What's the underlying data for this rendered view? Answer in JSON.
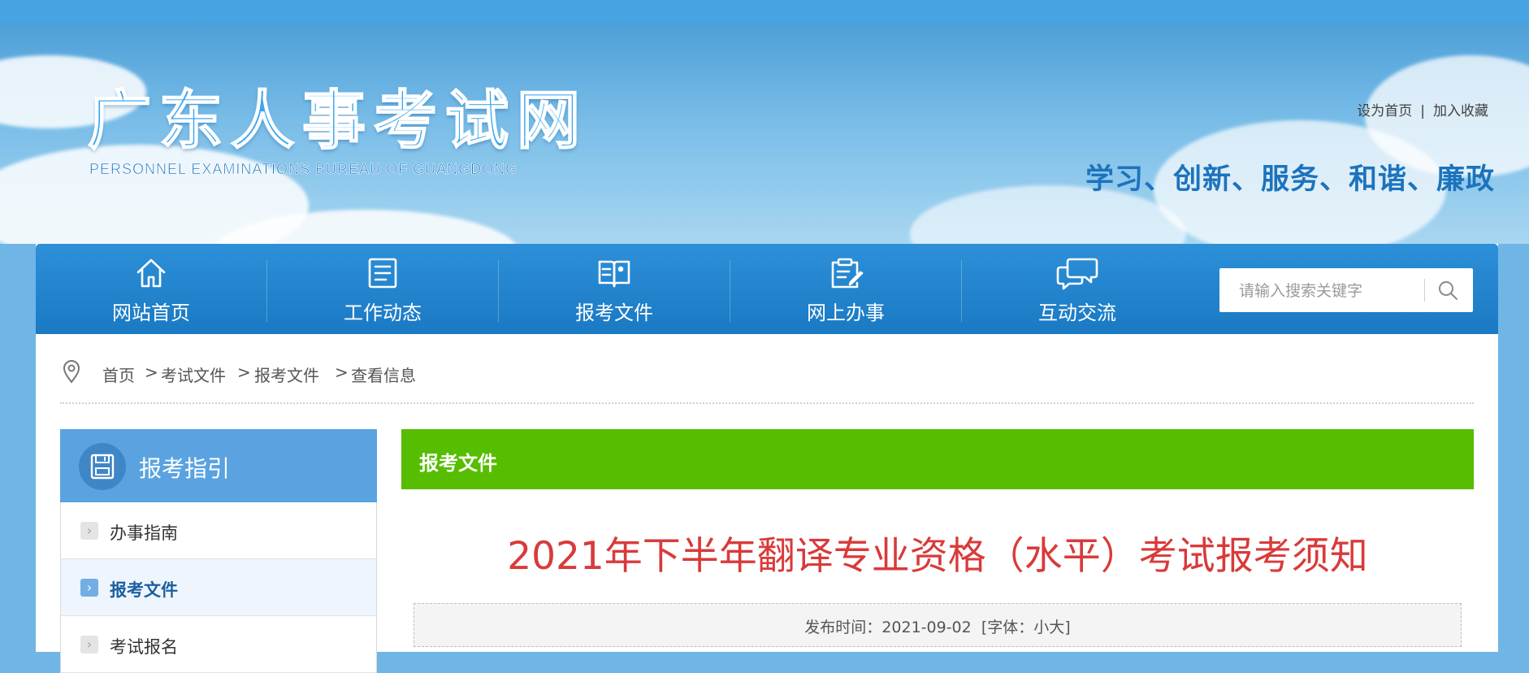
{
  "header": {
    "logo_cn": "广东人事考试网",
    "logo_en": "PERSONNEL EXAMINATIONS BUREAU OF GUANGDONG",
    "set_homepage": "设为首页",
    "separator": "|",
    "add_favorite": "加入收藏",
    "slogan": "学习、创新、服务、和谐、廉政"
  },
  "nav": {
    "items": [
      {
        "label": "网站首页",
        "icon": "home-icon"
      },
      {
        "label": "工作动态",
        "icon": "document-list-icon"
      },
      {
        "label": "报考文件",
        "icon": "open-book-icon"
      },
      {
        "label": "网上办事",
        "icon": "clipboard-pen-icon"
      },
      {
        "label": "互动交流",
        "icon": "chat-bubbles-icon"
      }
    ],
    "search_placeholder": "请输入搜索关键字"
  },
  "breadcrumb": {
    "items": [
      "首页",
      "考试文件",
      "报考文件",
      "查看信息"
    ],
    "separators": [
      ">",
      ">",
      ">"
    ]
  },
  "sidebar": {
    "title": "报考指引",
    "items": [
      {
        "label": "办事指南",
        "active": false
      },
      {
        "label": "报考文件",
        "active": true
      },
      {
        "label": "考试报名",
        "active": false
      }
    ]
  },
  "main": {
    "section_title": "报考文件",
    "article_title": "2021年下半年翻译专业资格（水平）考试报考须知",
    "meta": {
      "publish_label": "发布时间：",
      "publish_date": "2021-09-02",
      "font_prefix": "[字体：",
      "font_small": "小",
      "font_large": "大",
      "font_suffix": "]"
    }
  },
  "colors": {
    "nav_blue": "#1a79c3",
    "section_green": "#56bd00",
    "title_red": "#d93a3a",
    "sidebar_blue": "#5aa3e0"
  }
}
